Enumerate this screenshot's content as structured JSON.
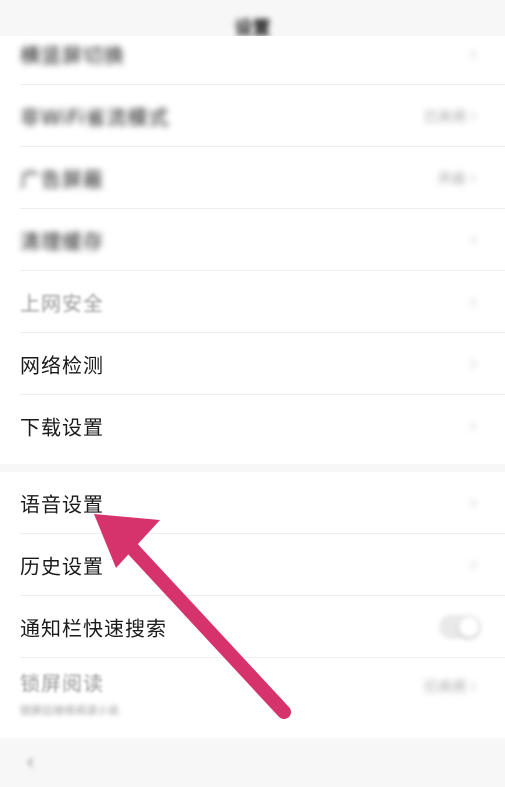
{
  "header": {
    "title": "设置"
  },
  "group1": {
    "rows": [
      {
        "label": "横竖屏切换",
        "right": ""
      },
      {
        "label": "非WiFi省流模式",
        "right": "已关闭"
      },
      {
        "label": "广告屏蔽",
        "right": "开启"
      },
      {
        "label": "清理缓存",
        "right": ""
      },
      {
        "label": "上网安全",
        "right": ""
      },
      {
        "label": "网络检测",
        "right": ""
      },
      {
        "label": "下载设置",
        "right": ""
      }
    ]
  },
  "group2": {
    "rows": [
      {
        "label": "语音设置"
      },
      {
        "label": "历史设置"
      },
      {
        "label": "通知栏快速搜索",
        "toggle": "off"
      },
      {
        "label": "锁屏阅读",
        "right": "已关闭",
        "sub": "锁屏后继续阅读小说"
      }
    ]
  },
  "footer": {
    "back_icon": "‹"
  },
  "colors": {
    "arrow": "#d6336c"
  }
}
